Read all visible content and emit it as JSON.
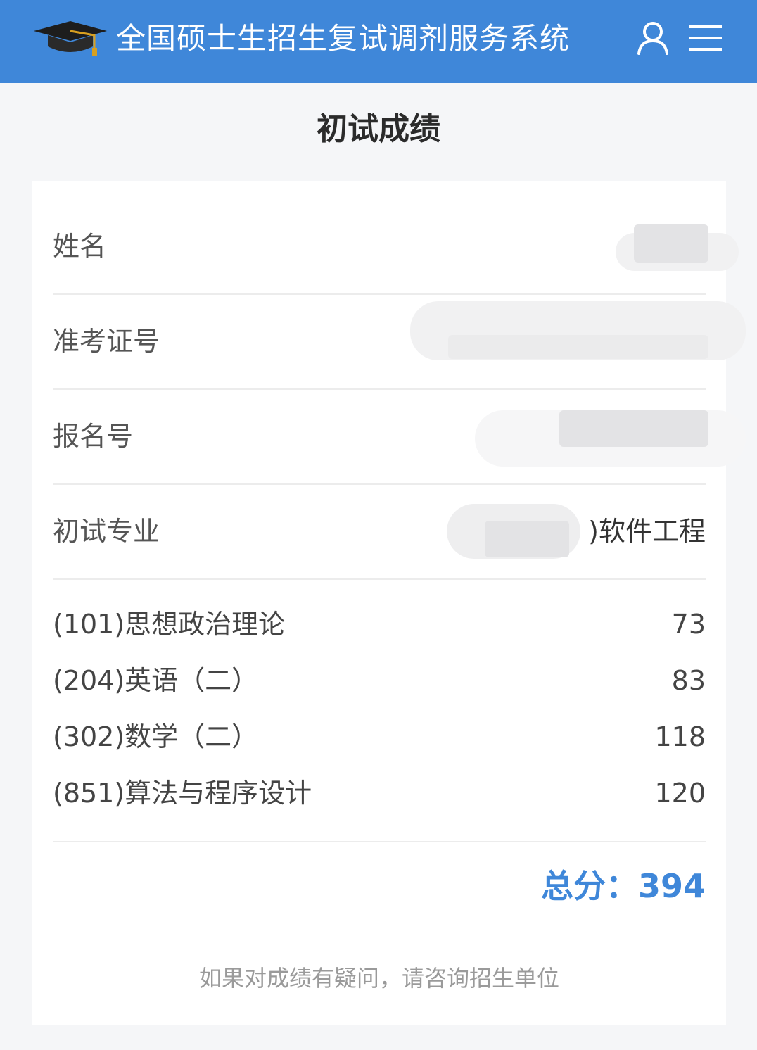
{
  "header": {
    "app_title": "全国硕士生招生复试调剂服务系统",
    "logo_icon": "graduation-cap-icon",
    "user_icon": "user-icon",
    "menu_icon": "hamburger-menu-icon",
    "bg_color": "#3f87d9"
  },
  "page": {
    "title": "初试成绩"
  },
  "info": {
    "name_label": "姓名",
    "exam_id_label": "准考证号",
    "registration_label": "报名号",
    "major_label": "初试专业",
    "major_value": ")软件工程"
  },
  "scores": [
    {
      "subject": "(101)思想政治理论",
      "score": "73"
    },
    {
      "subject": "(204)英语（二）",
      "score": "83"
    },
    {
      "subject": "(302)数学（二）",
      "score": "118"
    },
    {
      "subject": "(851)算法与程序设计",
      "score": "120"
    }
  ],
  "total": {
    "label": "总分：",
    "value": "394"
  },
  "footer_note": "如果对成绩有疑问，请咨询招生单位",
  "colors": {
    "accent": "#3f87d9",
    "background": "#f5f6f8"
  }
}
